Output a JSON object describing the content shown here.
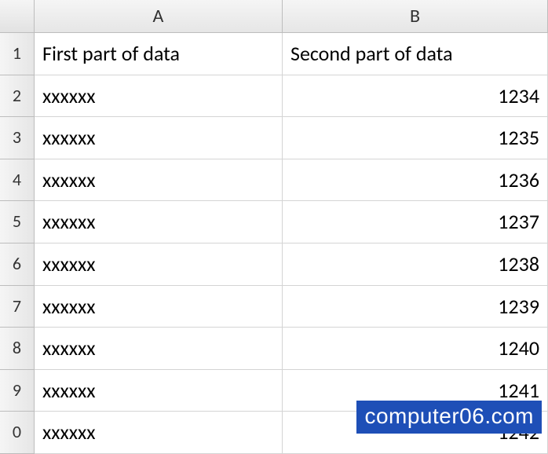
{
  "columns": {
    "a": "A",
    "b": "B"
  },
  "rows": {
    "r1": "1",
    "r2": "2",
    "r3": "3",
    "r4": "4",
    "r5": "5",
    "r6": "6",
    "r7": "7",
    "r8": "8",
    "r9": "9",
    "r10": "0"
  },
  "header": {
    "a": "First part of data",
    "b": "Second part of data"
  },
  "data": {
    "r2": {
      "a": "xxxxxx",
      "b": "1234"
    },
    "r3": {
      "a": "xxxxxx",
      "b": "1235"
    },
    "r4": {
      "a": "xxxxxx",
      "b": "1236"
    },
    "r5": {
      "a": "xxxxxx",
      "b": "1237"
    },
    "r6": {
      "a": "xxxxxx",
      "b": "1238"
    },
    "r7": {
      "a": "xxxxxx",
      "b": "1239"
    },
    "r8": {
      "a": "xxxxxx",
      "b": "1240"
    },
    "r9": {
      "a": "xxxxxx",
      "b": "1241"
    },
    "r10": {
      "a": "xxxxxx",
      "b": "1242"
    }
  },
  "watermark": "computer06.com"
}
